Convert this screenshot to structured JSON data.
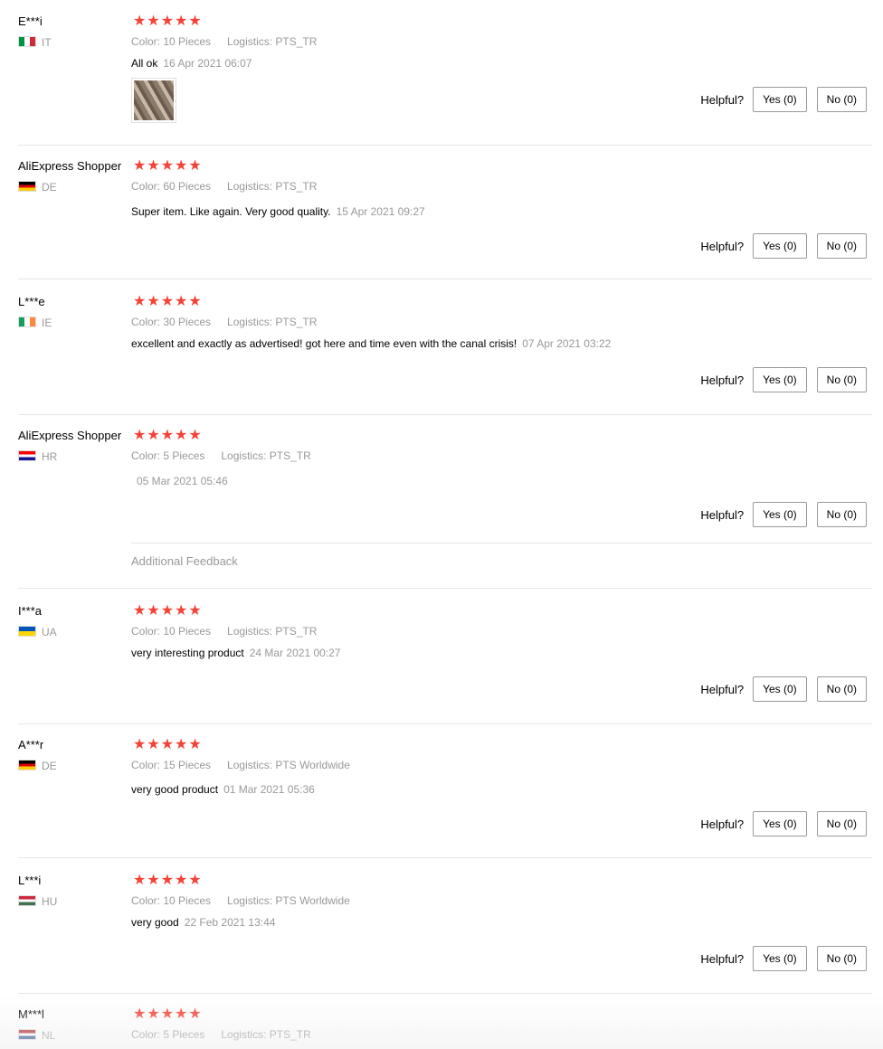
{
  "helpful_label": "Helpful?",
  "star_glyph": "★",
  "reviews": [
    {
      "user": "E***i",
      "country": "IT",
      "color": "Color: 10 Pieces",
      "logistics": "Logistics: PTS_TR",
      "text": "All ok",
      "date": "16 Apr 2021 06:07",
      "yes": "Yes (0)",
      "no": "No (0)",
      "stars": 5,
      "has_photo": true
    },
    {
      "user": "AliExpress Shopper",
      "country": "DE",
      "color": "Color: 60 Pieces",
      "logistics": "Logistics: PTS_TR",
      "text": "Super item. Like again. Very good quality.",
      "date": "15 Apr 2021 09:27",
      "yes": "Yes (0)",
      "no": "No (0)",
      "stars": 5
    },
    {
      "user": "L***e",
      "country": "IE",
      "color": "Color: 30 Pieces",
      "logistics": "Logistics: PTS_TR",
      "text": "excellent and exactly as advertised! got here and time even with the canal crisis!",
      "date": "07 Apr 2021 03:22",
      "yes": "Yes (0)",
      "no": "No (0)",
      "stars": 5
    },
    {
      "user": "AliExpress Shopper",
      "country": "HR",
      "color": "Color: 5 Pieces",
      "logistics": "Logistics: PTS_TR",
      "text": "",
      "date": "05 Mar 2021 05:46",
      "yes": "Yes (0)",
      "no": "No (0)",
      "stars": 5,
      "additional_feedback": "Additional Feedback"
    },
    {
      "user": "I***a",
      "country": "UA",
      "color": "Color: 10 Pieces",
      "logistics": "Logistics: PTS_TR",
      "text": "very interesting product",
      "date": "24 Mar 2021 00:27",
      "yes": "Yes (0)",
      "no": "No (0)",
      "stars": 5
    },
    {
      "user": "A***r",
      "country": "DE",
      "color": "Color: 15 Pieces",
      "logistics": "Logistics: PTS Worldwide",
      "text": "very good product",
      "date": "01 Mar 2021 05:36",
      "yes": "Yes (0)",
      "no": "No (0)",
      "stars": 5
    },
    {
      "user": "L***i",
      "country": "HU",
      "color": "Color: 10 Pieces",
      "logistics": "Logistics: PTS Worldwide",
      "text": "very good",
      "date": "22 Feb 2021 13:44",
      "yes": "Yes (0)",
      "no": "No (0)",
      "stars": 5
    },
    {
      "user": "M***l",
      "country": "NL",
      "color": "Color: 5 Pieces",
      "logistics": "Logistics: PTS_TR",
      "stars": 5
    }
  ]
}
